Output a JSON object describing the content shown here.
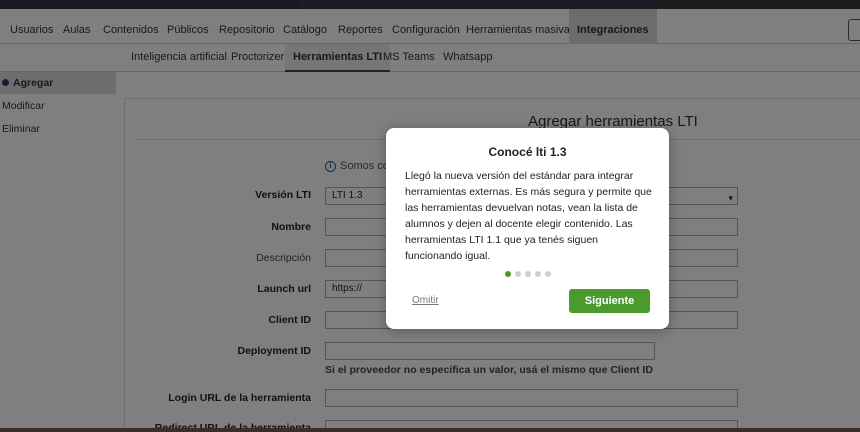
{
  "nav": {
    "items": [
      "Usuarios",
      "Aulas",
      "Contenidos",
      "Públicos",
      "Repositorio",
      "Catálogo",
      "Reportes",
      "Configuración",
      "Herramientas masivas"
    ],
    "active": "Integraciones"
  },
  "subnav": {
    "items": [
      "Inteligencia artificial",
      "Proctorizer"
    ],
    "active": "Herramientas LTI",
    "rest": [
      "MS Teams",
      "Whatsapp"
    ]
  },
  "sidebar": {
    "items": [
      "Agregar",
      "Modificar",
      "Eliminar"
    ]
  },
  "form": {
    "title": "Agregar herramientas LTI",
    "info": "Somos co",
    "fields": [
      {
        "label": "Versión LTI",
        "value": "LTI 1.3"
      },
      {
        "label": "Nombre",
        "value": ""
      },
      {
        "label": "Descripción",
        "value": ""
      },
      {
        "label": "Launch url",
        "value": "https://"
      },
      {
        "label": "Client ID",
        "value": ""
      },
      {
        "label": "Deployment ID",
        "value": ""
      },
      {
        "label": "Login URL de la herramienta",
        "value": ""
      },
      {
        "label": "Redirect URL de la herramienta",
        "value": ""
      }
    ],
    "hint": "Si el proveedor no especifica un valor, usá el mismo que Client ID"
  },
  "modal": {
    "title": "Conocé lti 1.3",
    "body": "Llegó la nueva versión del estándar para integrar herramientas externas. Es más segura y permite que las herramientas devuelvan notas, vean la lista de alumnos y dejen al docente elegir contenido. Las herramientas LTI 1.1 que ya tenés siguen funcionando igual.",
    "total_steps": 5,
    "current_step": 1,
    "skip_label": "Omitir",
    "next_label": "Siguiente"
  },
  "colors": {
    "accent_green": "#4a9a2e",
    "nav_dark": "#2b2f3a"
  }
}
